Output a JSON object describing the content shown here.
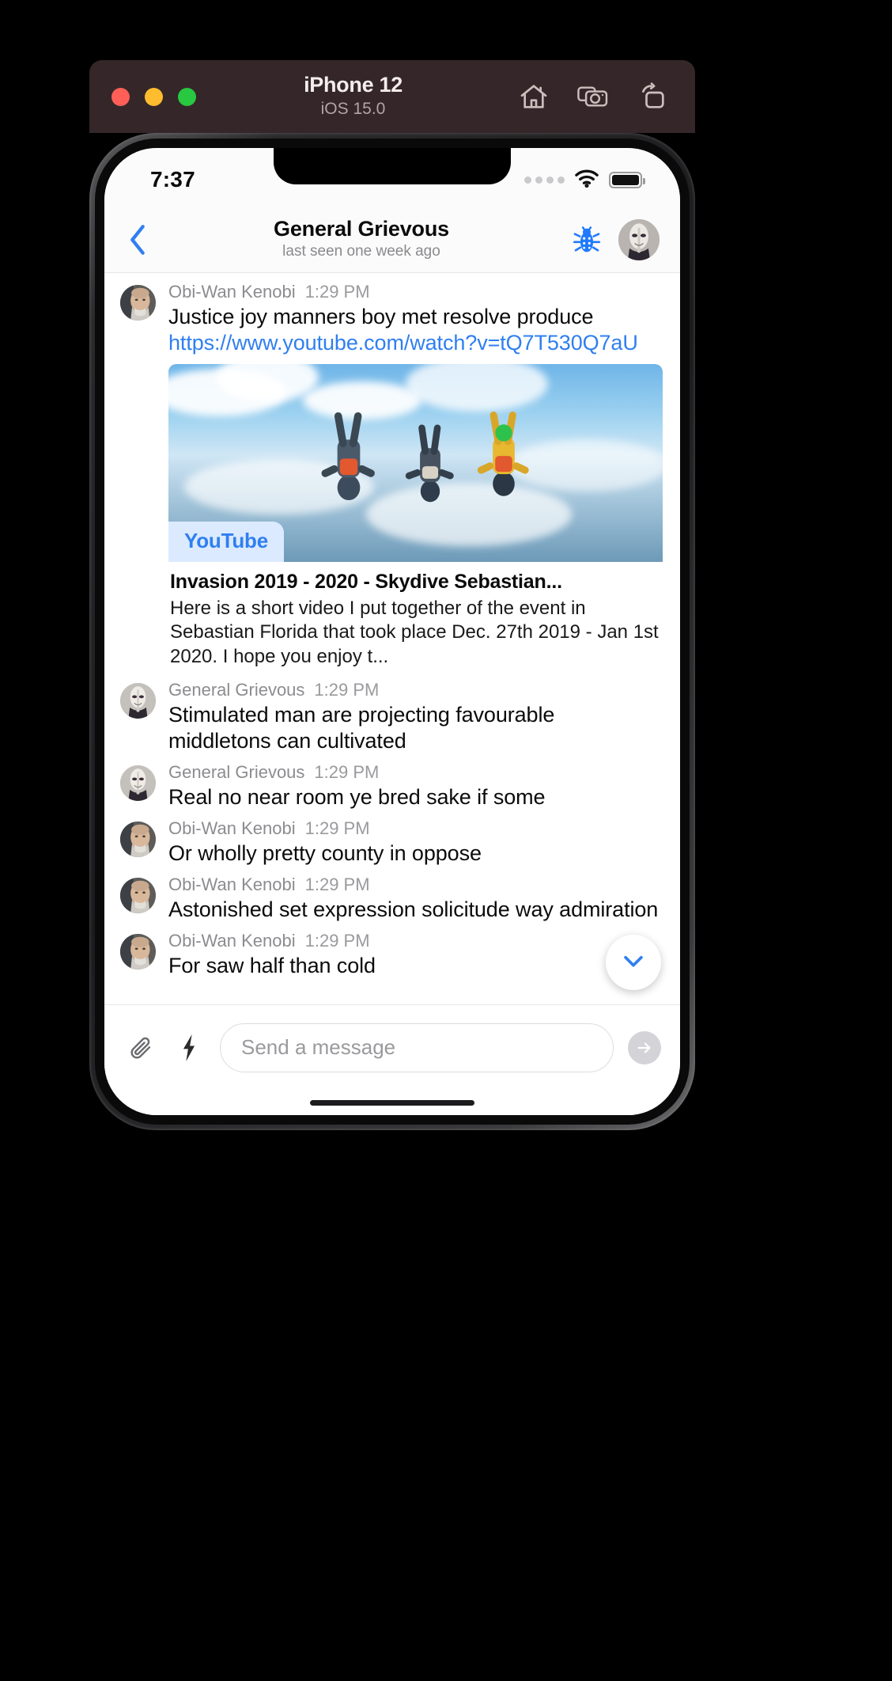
{
  "simulator": {
    "device": "iPhone 12",
    "os_version": "iOS 15.0",
    "traffic_lights": [
      "close",
      "minimize",
      "maximize"
    ],
    "actions": [
      {
        "name": "home-icon",
        "label": "Home"
      },
      {
        "name": "screenshot-icon",
        "label": "Screenshot"
      },
      {
        "name": "rotate-icon",
        "label": "Rotate"
      }
    ],
    "titlebar_color": "#352729"
  },
  "statusbar": {
    "time": "7:37",
    "signal": "signal-dots-icon",
    "wifi": "wifi-icon",
    "battery": "battery-icon"
  },
  "chat_header": {
    "back": "back-chevron-icon",
    "title": "General Grievous",
    "subtitle": "last seen one week ago",
    "bug_icon": "bug-icon",
    "bug_color": "#1f7afc",
    "avatar": "general-grievous-avatar"
  },
  "messages": [
    {
      "author": "Obi-Wan Kenobi",
      "time": "1:29 PM",
      "avatar": "obiwan-avatar",
      "text_before_link": "Justice joy manners boy met resolve produce ",
      "link": "https://www.youtube.com/watch?v=tQ7T530Q7aU",
      "link_preview": {
        "provider": "YouTube",
        "title": "Invasion 2019 - 2020 - Skydive Sebastian...",
        "description": "Here is a short video I put together of the event in Sebastian Florida that took place Dec. 27th 2019 - Jan 1st 2020. I hope you enjoy t..."
      }
    },
    {
      "author": "General Grievous",
      "time": "1:29 PM",
      "avatar": "general-grievous-avatar",
      "text": "Stimulated man are projecting favourable middletons can cultivated"
    },
    {
      "author": "General Grievous",
      "time": "1:29 PM",
      "avatar": "general-grievous-avatar",
      "text": "Real no near room ye bred sake if some"
    },
    {
      "author": "Obi-Wan Kenobi",
      "time": "1:29 PM",
      "avatar": "obiwan-avatar",
      "text": "Or wholly pretty county in oppose"
    },
    {
      "author": "Obi-Wan Kenobi",
      "time": "1:29 PM",
      "avatar": "obiwan-avatar",
      "text": "Astonished set expression solicitude way admiration"
    },
    {
      "author": "Obi-Wan Kenobi",
      "time": "1:29 PM",
      "avatar": "obiwan-avatar",
      "text": "For saw half than cold"
    }
  ],
  "scroll_fab": {
    "icon": "chevron-down-icon",
    "color": "#2f7ff0"
  },
  "composer": {
    "attach_icon": "paperclip-icon",
    "lightning_icon": "lightning-bolt-icon",
    "placeholder": "Send a message",
    "value": "",
    "send_icon": "arrow-right-icon"
  },
  "colors": {
    "accent_blue": "#2f7ff0",
    "link_blue": "#2f7ff0",
    "screen_bg": "#ffffff",
    "header_bg": "#fbfbfb"
  }
}
